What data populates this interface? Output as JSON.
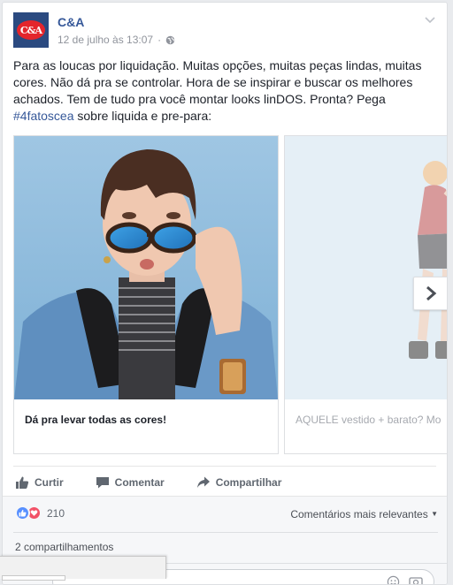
{
  "post": {
    "page_name": "C&A",
    "avatar_text": "C&A",
    "timestamp": "12 de julho às 13:07",
    "timestamp_sep": "·",
    "body_text": "Para as loucas por liquidação. Muitas opções, muitas peças lindas, muitas cores. Não dá pra se controlar. Hora de se inspirar e buscar os melhores achados. Tem de tudo pra você montar looks linDOS. Pronta? Pega ",
    "hashtag": "#4fatoscea",
    "body_text_end": " sobre liquida e pre-para:"
  },
  "carousel": {
    "cards": [
      {
        "caption": "Dá pra levar todas as cores!"
      },
      {
        "caption": "AQUELE vestido + barato? Mo"
      }
    ]
  },
  "actions": {
    "like": "Curtir",
    "comment": "Comentar",
    "share": "Compartilhar"
  },
  "stats": {
    "reaction_count": "210",
    "sort_label": "Comentários mais relevantes",
    "shares": "2 compartilhamentos"
  },
  "colors": {
    "brand_blue": "#365899",
    "like_blue": "#5890ff",
    "love_red": "#f25268",
    "logo_red": "#e4252c"
  }
}
